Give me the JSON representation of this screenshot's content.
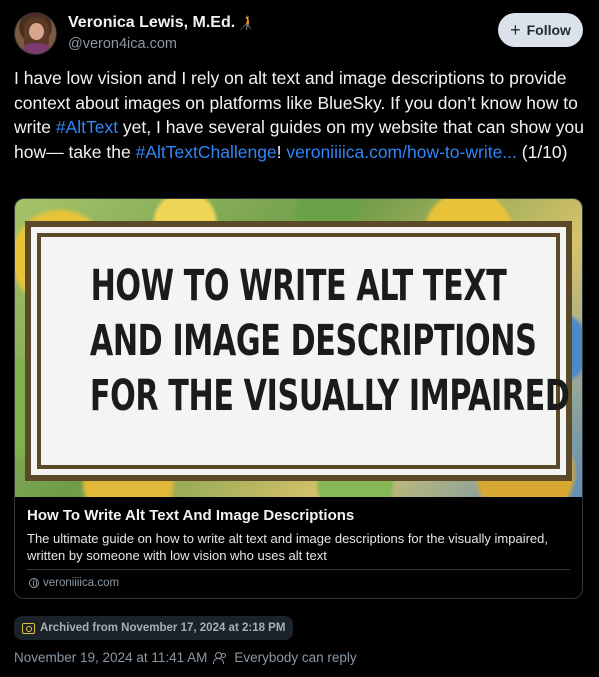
{
  "author": {
    "name": "Veronica Lewis, M.Ed.",
    "emoji": "🧑‍🦯",
    "handle": "@veron4ica.com"
  },
  "follow_button": {
    "label": "Follow"
  },
  "post": {
    "text_part1": "I have low vision and I rely on alt text and image descriptions to provide context about images on platforms like BlueSky. If you don’t know how to write ",
    "hashtag1": "#AltText",
    "text_part2": " yet, I have several guides on my website that can show you how— take the ",
    "hashtag2": "#AltTextChallenge",
    "text_part3": "! ",
    "link": "veroniiiica.com/how-to-write...",
    "text_part4": " (1/10)"
  },
  "link_card": {
    "image_headline_line1": "HOW TO WRITE ALT TEXT",
    "image_headline_line2": "AND IMAGE DESCRIPTIONS",
    "image_headline_line3": "FOR THE VISUALLY IMPAIRED",
    "title": "How To Write Alt Text And Image Descriptions",
    "description": "The ultimate guide on how to write alt text and image descriptions for the visually impaired, written by someone with low vision who uses alt text",
    "domain": "veroniiiica.com"
  },
  "archive_badge": {
    "label": "Archived from November 17, 2024 at 2:18 PM"
  },
  "meta": {
    "timestamp": "November 19, 2024 at 11:41 AM",
    "reply_setting": "Everybody can reply"
  },
  "colors": {
    "background": "#000000",
    "link": "#2f86f6",
    "muted": "#8b98a5",
    "follow_bg": "#dce2ea"
  }
}
